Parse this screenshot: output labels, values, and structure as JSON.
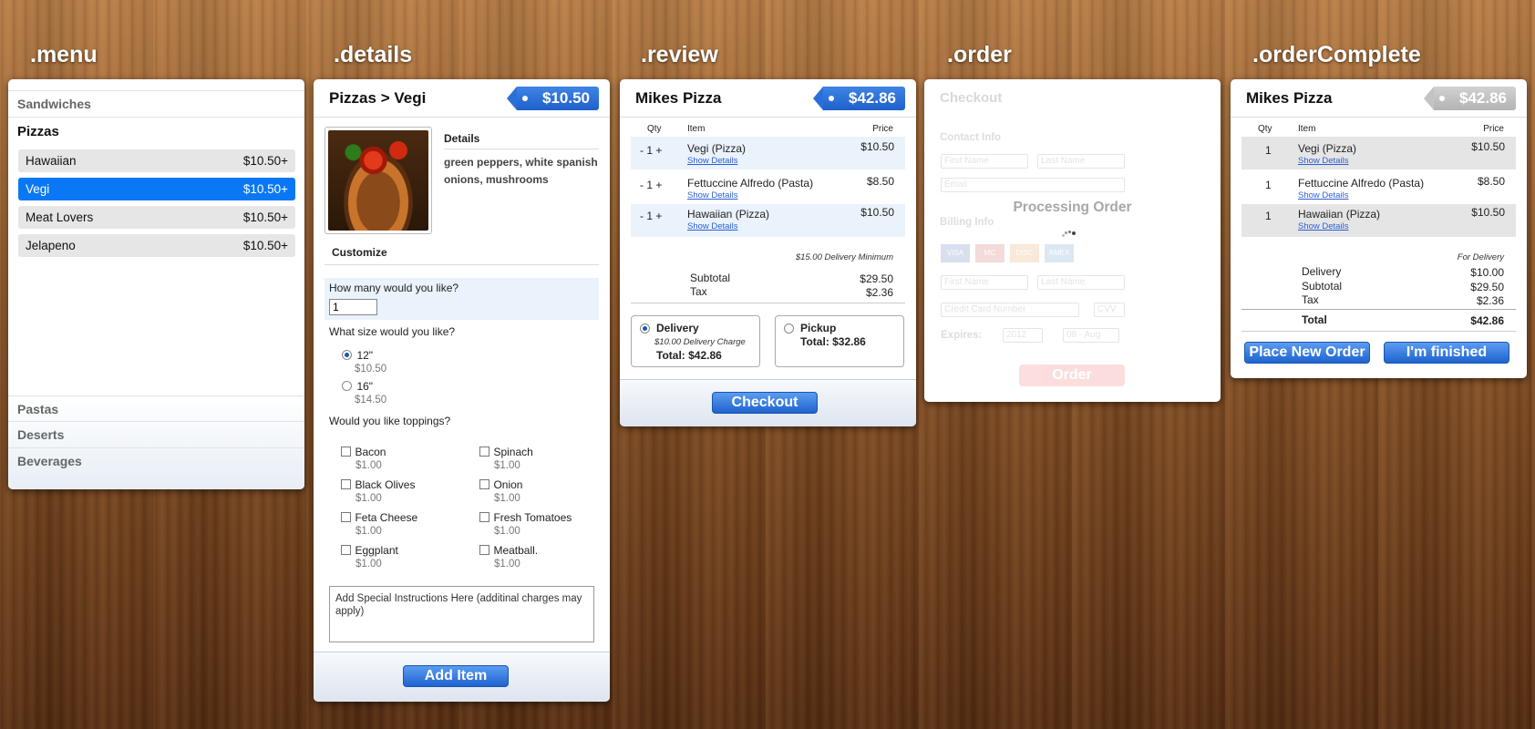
{
  "labels": {
    "menu": ".menu",
    "details": ".details",
    "review": ".review",
    "order": ".order",
    "complete": ".orderComplete"
  },
  "menu": {
    "categories_top": [
      "Sandwiches",
      "Pizzas"
    ],
    "items": [
      {
        "name": "Hawaiian",
        "price": "$10.50+"
      },
      {
        "name": "Vegi",
        "price": "$10.50+"
      },
      {
        "name": "Meat Lovers",
        "price": "$10.50+"
      },
      {
        "name": "Jelapeno",
        "price": "$10.50+"
      }
    ],
    "categories_bottom": [
      "Pastas",
      "Deserts",
      "Beverages"
    ]
  },
  "details": {
    "title": "Pizzas > Vegi",
    "price": "$10.50",
    "details_heading": "Details",
    "details_text": "green peppers, white spanish onions, mushrooms",
    "customize": "Customize",
    "qty_question": "How many would you like?",
    "qty_value": "1",
    "size_question": "What size would you like?",
    "sizes": [
      {
        "label": "12\"",
        "price": "$10.50"
      },
      {
        "label": "16\"",
        "price": "$14.50"
      }
    ],
    "toppings_question": "Would you like toppings?",
    "toppings": [
      {
        "name": "Bacon",
        "price": "$1.00"
      },
      {
        "name": "Spinach",
        "price": "$1.00"
      },
      {
        "name": "Black Olives",
        "price": "$1.00"
      },
      {
        "name": "Onion",
        "price": "$1.00"
      },
      {
        "name": "Feta Cheese",
        "price": "$1.00"
      },
      {
        "name": "Fresh Tomatoes",
        "price": "$1.00"
      },
      {
        "name": "Eggplant",
        "price": "$1.00"
      },
      {
        "name": "Meatball.",
        "price": "$1.00"
      }
    ],
    "instructions": "Add Special Instructions Here (additinal charges may apply)",
    "add_button": "Add Item"
  },
  "review": {
    "title": "Mikes Pizza",
    "price": "$42.86",
    "headers": {
      "qty": "Qty",
      "item": "Item",
      "price": "Price"
    },
    "items": [
      {
        "qty": "- 1 +",
        "name": "Vegi (Pizza)",
        "price": "$10.50"
      },
      {
        "qty": "- 1 +",
        "name": "Fettuccine Alfredo (Pasta)",
        "price": "$8.50"
      },
      {
        "qty": "- 1 +",
        "name": "Hawaiian (Pizza)",
        "price": "$10.50"
      }
    ],
    "show_details": "Show Details",
    "minimum": "$15.00 Delivery Minimum",
    "subtotal_label": "Subtotal",
    "subtotal": "$29.50",
    "tax_label": "Tax",
    "tax": "$2.36",
    "delivery": {
      "label": "Delivery",
      "charge": "$10.00 Delivery Charge",
      "total": "Total: $42.86"
    },
    "pickup": {
      "label": "Pickup",
      "total": "Total: $32.86"
    },
    "checkout_button": "Checkout"
  },
  "order": {
    "checkout": "Checkout",
    "contact": "Contact Info",
    "first": "First Name",
    "last": "Last Name",
    "email": "Email",
    "billing": "Billing Info",
    "cards": [
      "VISA",
      "MC",
      "DISC",
      "AMEX"
    ],
    "cc_first": "First Name",
    "cc_last": "Last Name",
    "cc_number": "Credit Card Number",
    "cvv": "CVV",
    "expires": "Expires:",
    "year": "2012",
    "month": "08 - Aug",
    "processing": "Processing Order",
    "order_button": "Order"
  },
  "complete": {
    "title": "Mikes Pizza",
    "price": "$42.86",
    "headers": {
      "qty": "Qty",
      "item": "Item",
      "price": "Price"
    },
    "items": [
      {
        "qty": "1",
        "name": "Vegi (Pizza)",
        "price": "$10.50"
      },
      {
        "qty": "1",
        "name": "Fettuccine Alfredo (Pasta)",
        "price": "$8.50"
      },
      {
        "qty": "1",
        "name": "Hawaiian (Pizza)",
        "price": "$10.50"
      }
    ],
    "show_details": "Show Details",
    "for_delivery": "For Delivery",
    "delivery_label": "Delivery",
    "delivery": "$10.00",
    "subtotal_label": "Subtotal",
    "subtotal": "$29.50",
    "tax_label": "Tax",
    "tax": "$2.36",
    "total_label": "Total",
    "total": "$42.86",
    "new_order_button": "Place New Order",
    "finished_button": "I'm finished"
  }
}
